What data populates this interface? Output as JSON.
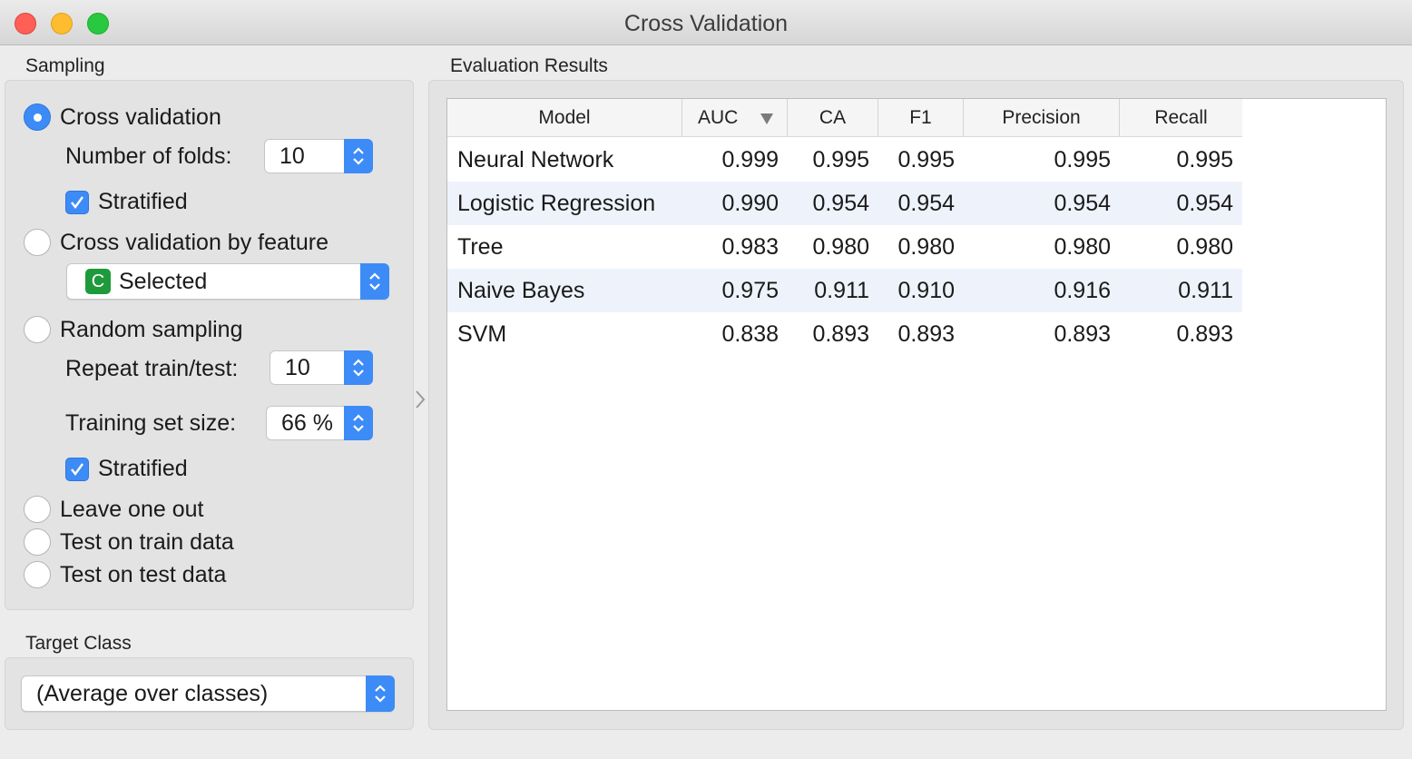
{
  "window": {
    "title": "Cross Validation"
  },
  "sampling": {
    "label": "Sampling",
    "cross_validation": {
      "label": "Cross validation",
      "selected": true
    },
    "folds": {
      "label": "Number of folds:",
      "value": "10"
    },
    "stratified1": {
      "label": "Stratified",
      "checked": true
    },
    "cv_by_feature": {
      "label": "Cross validation by feature",
      "selected": false
    },
    "feature_combo": {
      "badge": "C",
      "value": "Selected"
    },
    "random_sampling": {
      "label": "Random sampling",
      "selected": false
    },
    "repeat": {
      "label": "Repeat train/test:",
      "value": "10"
    },
    "train_size": {
      "label": "Training set size:",
      "value": "66 %"
    },
    "stratified2": {
      "label": "Stratified",
      "checked": true
    },
    "leave_one_out": {
      "label": "Leave one out",
      "selected": false
    },
    "test_on_train": {
      "label": "Test on train data",
      "selected": false
    },
    "test_on_test": {
      "label": "Test on test data",
      "selected": false
    }
  },
  "target_class": {
    "label": "Target Class",
    "value": "(Average over classes)"
  },
  "results": {
    "label": "Evaluation Results",
    "columns": [
      "Model",
      "AUC",
      "CA",
      "F1",
      "Precision",
      "Recall"
    ],
    "sorted_column": "AUC",
    "rows": [
      [
        "Neural Network",
        "0.999",
        "0.995",
        "0.995",
        "0.995",
        "0.995"
      ],
      [
        "Logistic Regression",
        "0.990",
        "0.954",
        "0.954",
        "0.954",
        "0.954"
      ],
      [
        "Tree",
        "0.983",
        "0.980",
        "0.980",
        "0.980",
        "0.980"
      ],
      [
        "Naive Bayes",
        "0.975",
        "0.911",
        "0.910",
        "0.916",
        "0.911"
      ],
      [
        "SVM",
        "0.838",
        "0.893",
        "0.893",
        "0.893",
        "0.893"
      ]
    ]
  },
  "colors": {
    "accent": "#3d8bf7",
    "row_alt": "#eef3fb",
    "badge_green": "#1f9a3b"
  }
}
